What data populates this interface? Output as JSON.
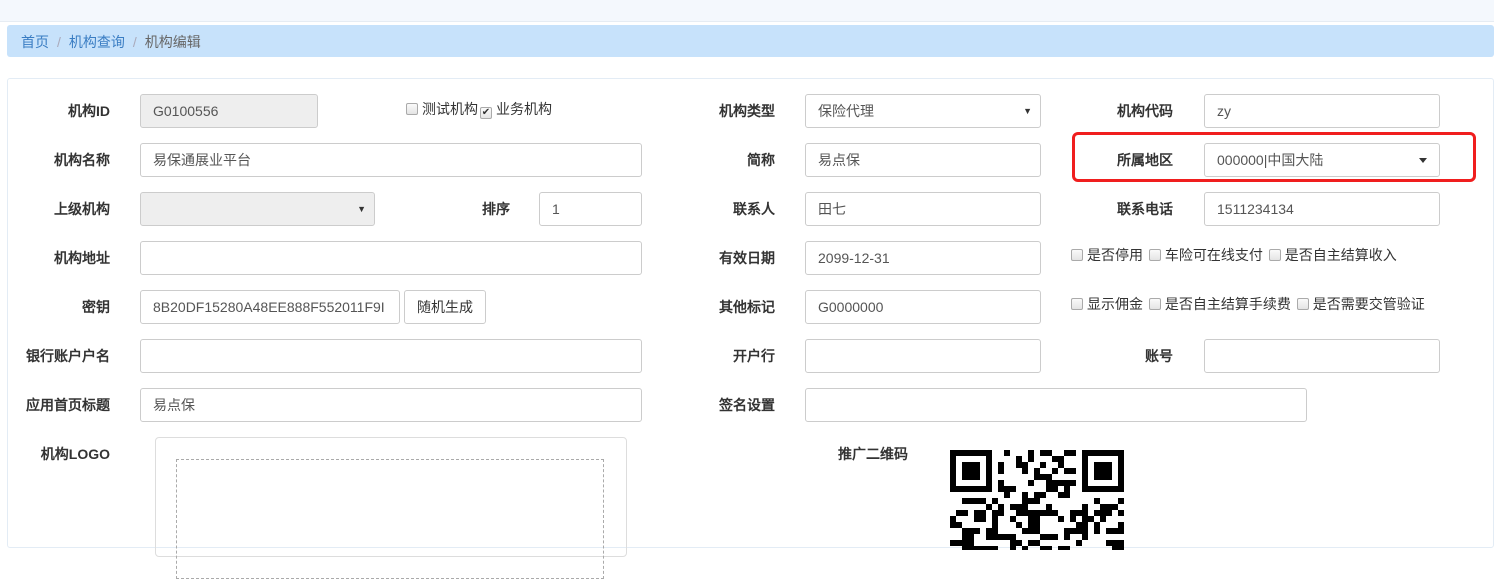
{
  "breadcrumb": {
    "home": "首页",
    "list": "机构查询",
    "current": "机构编辑",
    "sep": "/"
  },
  "form": {
    "org_id": {
      "label": "机构ID",
      "value": "G0100556"
    },
    "test_org": {
      "label": "测试机构",
      "checked": false
    },
    "biz_org": {
      "label": "业务机构",
      "checked": true
    },
    "org_type": {
      "label": "机构类型",
      "value": "保险代理"
    },
    "org_code": {
      "label": "机构代码",
      "value": "zy"
    },
    "org_name": {
      "label": "机构名称",
      "value": "易保通展业平台"
    },
    "short_name": {
      "label": "简称",
      "value": "易点保"
    },
    "region": {
      "label": "所属地区",
      "value": "000000|中国大陆"
    },
    "parent_org": {
      "label": "上级机构",
      "value": ""
    },
    "sort": {
      "label": "排序",
      "value": "1"
    },
    "contact": {
      "label": "联系人",
      "value": "田七"
    },
    "phone": {
      "label": "联系电话",
      "value": "1511234134"
    },
    "address": {
      "label": "机构地址",
      "value": ""
    },
    "valid_date": {
      "label": "有效日期",
      "value": "2099-12-31"
    },
    "disabled": {
      "label": "是否停用",
      "checked": false
    },
    "online_pay": {
      "label": "车险可在线支付",
      "checked": false
    },
    "self_settle_income": {
      "label": "是否自主结算收入",
      "checked": false
    },
    "secret": {
      "label": "密钥",
      "value": "8B20DF15280A48EE888F552011F9I"
    },
    "random_btn": "随机生成",
    "other_mark": {
      "label": "其他标记",
      "value": "G0000000"
    },
    "show_commission": {
      "label": "显示佣金",
      "checked": false
    },
    "self_settle_fee": {
      "label": "是否自主结算手续费",
      "checked": false
    },
    "traffic_verify": {
      "label": "是否需要交管验证",
      "checked": false
    },
    "bank_account_name": {
      "label": "银行账户户名",
      "value": ""
    },
    "bank": {
      "label": "开户行",
      "value": ""
    },
    "account_no": {
      "label": "账号",
      "value": ""
    },
    "app_title": {
      "label": "应用首页标题",
      "value": "易点保"
    },
    "signature": {
      "label": "签名设置",
      "value": ""
    },
    "logo": {
      "label": "机构LOGO"
    },
    "qrcode": {
      "label": "推广二维码"
    }
  },
  "colors": {
    "highlight": "#f01e1e",
    "breadcrumb_bg": "#c7e2fb",
    "link": "#3a7dc3"
  }
}
